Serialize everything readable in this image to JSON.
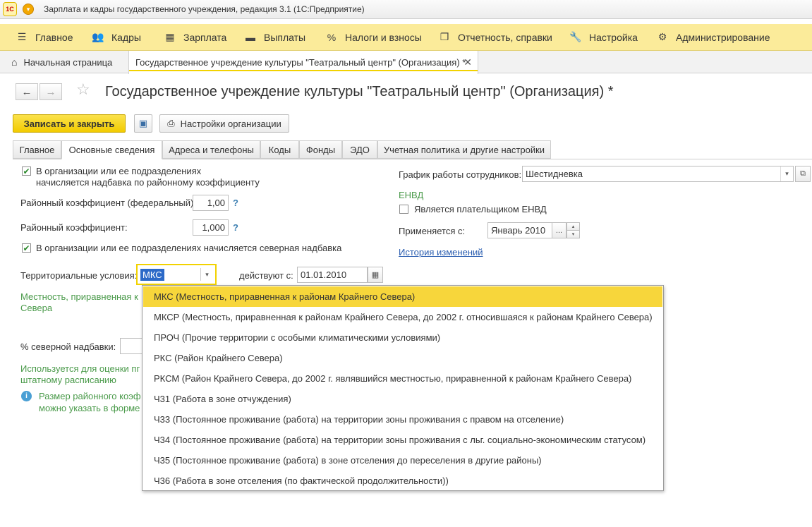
{
  "window": {
    "logo_text": "1С",
    "title": "Зарплата и кадры государственного учреждения, редакция 3.1  (1С:Предприятие)"
  },
  "sections": [
    {
      "icon": "menu-icon",
      "label": "Главное"
    },
    {
      "icon": "people-icon",
      "label": "Кадры"
    },
    {
      "icon": "calculator-icon",
      "label": "Зарплата"
    },
    {
      "icon": "wallet-icon",
      "label": "Выплаты"
    },
    {
      "icon": "percent-icon",
      "label": "Налоги и взносы"
    },
    {
      "icon": "reports-icon",
      "label": "Отчетность, справки"
    },
    {
      "icon": "wrench-icon",
      "label": "Настройка"
    },
    {
      "icon": "gear-icon",
      "label": "Администрирование"
    }
  ],
  "window_tabs": {
    "home_label": "Начальная страница",
    "active_label": "Государственное учреждение культуры \"Театральный центр\" (Организация) *"
  },
  "form": {
    "title": "Государственное учреждение культуры \"Театральный центр\" (Организация) *",
    "save_close_label": "Записать и закрыть",
    "org_settings_label": "Настройки организации",
    "tabs": [
      "Главное",
      "Основные сведения",
      "Адреса и телефоны",
      "Коды",
      "Фонды",
      "ЭДО",
      "Учетная политика и другие настройки"
    ],
    "active_tab": "Основные сведения"
  },
  "left": {
    "regional_check_line1": "В организации или ее подразделениях",
    "regional_check_line2": "начисляется надбавка по районному коэффициенту",
    "regional_checked": true,
    "federal_coef_label": "Районный коэффициент (федеральный):",
    "federal_coef_value": "1,00",
    "coef_label": "Районный коэффициент:",
    "coef_value": "1,000",
    "help_mark": "?",
    "north_check_label": "В организации или ее подразделениях начисляется северная надбавка",
    "north_checked": true,
    "territorial_label": "Территориальные условия:",
    "territorial_value": "МКС",
    "valid_from_label": "действуют с:",
    "valid_from_value": "01.01.2010",
    "hint_line1": "Местность, приравненная к",
    "hint_line2": "Севера",
    "north_pct_label": "% северной надбавки:",
    "used_line1": "Используется для оценки пг",
    "used_line2": "штатному расписанию",
    "info_line1": "Размер районного коэф",
    "info_line2": "можно указать в форме"
  },
  "right": {
    "schedule_label": "График работы сотрудников:",
    "schedule_value": "Шестидневка",
    "envd_header": "ЕНВД",
    "envd_check_label": "Является плательщиком ЕНВД",
    "envd_checked": false,
    "applied_label": "Применяется с:",
    "applied_value": "Январь 2010",
    "history_link": "История изменений"
  },
  "dropdown": {
    "selected": "МКС (Местность, приравненная к районам Крайнего Севера)",
    "items": [
      "МКС (Местность, приравненная к районам Крайнего Севера)",
      "МКСР (Местность, приравненная к районам Крайнего Севера, до 2002 г. относившаяся к районам Крайнего Севера)",
      "ПРОЧ (Прочие территории с особыми климатическими условиями)",
      "РКС (Район Крайнего Севера)",
      "РКСМ (Район Крайнего Севера, до 2002 г. являвшийся местностью, приравненной к районам Крайнего Севера)",
      "Ч31 (Работа в зоне отчуждения)",
      "Ч33 (Постоянное проживание (работа) на территории зоны проживания с правом на отселение)",
      "Ч34 (Постоянное проживание (работа) на территории зоны проживания с льг. социально-экономическим статусом)",
      "Ч35 (Постоянное проживание (работа) в зоне отселения до переселения в другие районы)",
      "Ч36 (Работа в зоне отселения (по фактической продолжительности))"
    ]
  },
  "colors": {
    "section_bar": "#fbeb9a",
    "primary_button": "#f2cb00",
    "selected_item": "#f7d63b",
    "link": "#2a5db0",
    "hint_green": "#4a9a4a"
  }
}
